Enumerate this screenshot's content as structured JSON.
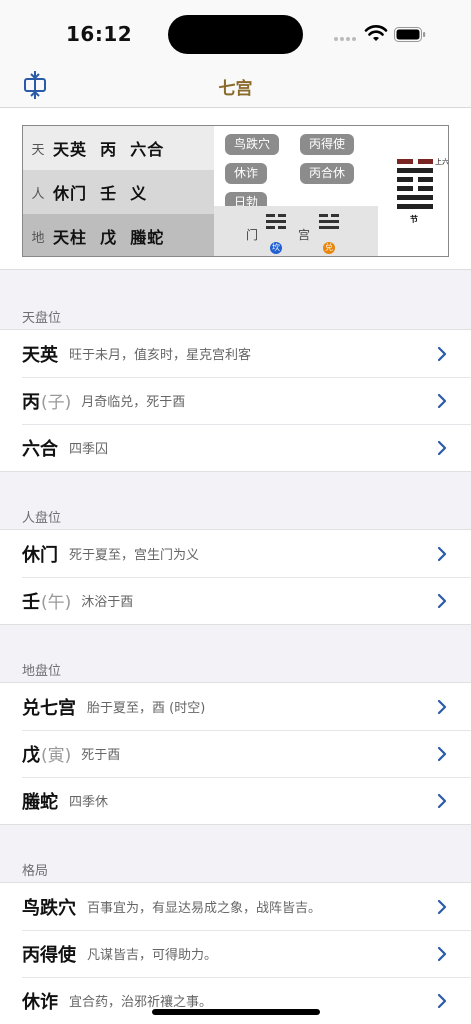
{
  "status_bar": {
    "time": "16:12"
  },
  "nav": {
    "title": "七宫",
    "left_icon": "vertical-split-icon"
  },
  "chart": {
    "rows": [
      {
        "label": "天",
        "text": "天英  丙  六合"
      },
      {
        "label": "人",
        "text": "休门  壬  义"
      },
      {
        "label": "地",
        "text": "天柱  戊  螣蛇"
      }
    ],
    "tags": [
      "鸟跌穴",
      "丙得使",
      "休诈",
      "丙合休",
      "日勃"
    ],
    "gate_label": "门",
    "gate_badge": "坎",
    "palace_label": "宫",
    "palace_badge": "兑",
    "hexagram_top_label": "上六",
    "hexagram_name": "节",
    "colors": {
      "gate_badge": "#1f5fd1",
      "palace_badge": "#e8860c",
      "hex_red": "#7a2424",
      "hex_dark": "#222222"
    }
  },
  "sections": [
    {
      "header": "天盘位",
      "rows": [
        {
          "title": "天英",
          "sub": "",
          "desc": "旺于未月，值亥时，星克宫利客"
        },
        {
          "title": "丙",
          "sub": "(子)",
          "desc": "月奇临兑，死于酉"
        },
        {
          "title": "六合",
          "sub": "",
          "desc": "四季囚"
        }
      ]
    },
    {
      "header": "人盘位",
      "rows": [
        {
          "title": "休门",
          "sub": "",
          "desc": "死于夏至，宫生门为义"
        },
        {
          "title": "壬",
          "sub": "(午)",
          "desc": "沐浴于酉"
        }
      ]
    },
    {
      "header": "地盘位",
      "rows": [
        {
          "title": "兑七宫",
          "sub": "",
          "desc": "胎于夏至，酉 (时空)"
        },
        {
          "title": "戊",
          "sub": "(寅)",
          "desc": "死于酉"
        },
        {
          "title": "螣蛇",
          "sub": "",
          "desc": "四季休"
        }
      ]
    },
    {
      "header": "格局",
      "rows": [
        {
          "title": "鸟跌穴",
          "sub": "",
          "desc": "百事宜为，有显达易成之象，战阵皆吉。"
        },
        {
          "title": "丙得使",
          "sub": "",
          "desc": "凡谋皆吉，可得助力。"
        },
        {
          "title": "休诈",
          "sub": "",
          "desc": "宜合药，治邪祈禳之事。"
        }
      ]
    }
  ],
  "accent_color": "#2a5aa8"
}
